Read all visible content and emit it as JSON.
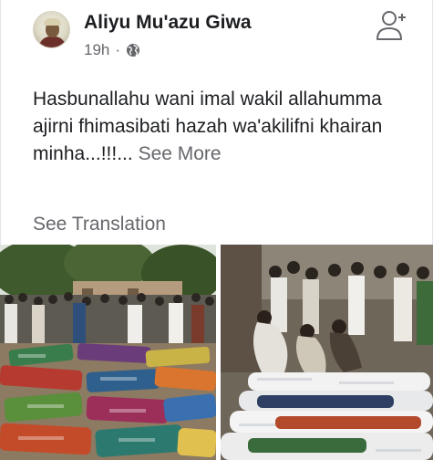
{
  "post": {
    "author": "Aliyu Mu'azu Giwa",
    "time": "19h",
    "separator": "·",
    "privacy_icon": "globe-icon",
    "text": "Hasbunallahu wani imal wakil allahumma ajirni fhimasibati hazah wa'akilifni khairan minha...!!!...",
    "see_more": "See More",
    "see_translation": "See Translation"
  },
  "header_actions": {
    "follow_icon": "add-friend-icon"
  },
  "photos": [
    {
      "icon": "photo-left"
    },
    {
      "icon": "photo-right"
    }
  ],
  "colors": {
    "text": "#1c1e21",
    "secondary": "#65676b"
  }
}
